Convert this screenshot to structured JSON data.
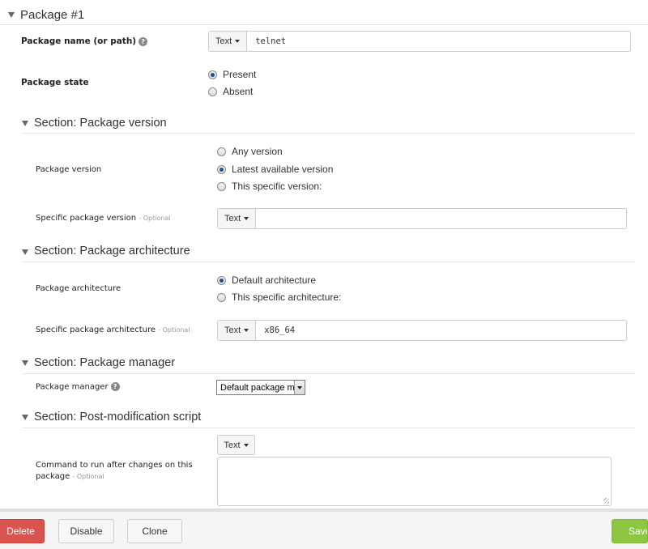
{
  "package": {
    "title": "Package #1",
    "name_label": "Package name (or path)",
    "name_type": "Text",
    "name_value": "telnet",
    "state_label": "Package state",
    "state_options": [
      "Present",
      "Absent"
    ],
    "state_selected": "Present"
  },
  "sections": {
    "version": {
      "title": "Section: Package version",
      "label": "Package version",
      "options": [
        "Any version",
        "Latest available version",
        "This specific version:"
      ],
      "selected": "Latest available version",
      "specific_label": "Specific package version",
      "optional": "- Optional",
      "specific_type": "Text",
      "specific_value": ""
    },
    "architecture": {
      "title": "Section: Package architecture",
      "label": "Package architecture",
      "options": [
        "Default architecture",
        "This specific architecture:"
      ],
      "selected": "Default architecture",
      "specific_label": "Specific package architecture",
      "optional": "- Optional",
      "specific_type": "Text",
      "specific_value": "x86_64"
    },
    "manager": {
      "title": "Section: Package manager",
      "label": "Package manager",
      "selected": "Default package m"
    },
    "post": {
      "title": "Section: Post-modification script",
      "label_line1": "Command to run after changes on this",
      "label_line2": "package",
      "optional": "- Optional",
      "type": "Text",
      "value": ""
    }
  },
  "footer": {
    "delete": "Delete",
    "disable": "Disable",
    "clone": "Clone",
    "save": "Save"
  },
  "colors": {
    "danger": "#d9534f",
    "success": "#8dc641",
    "radio_dot": "#1f4f8f"
  }
}
